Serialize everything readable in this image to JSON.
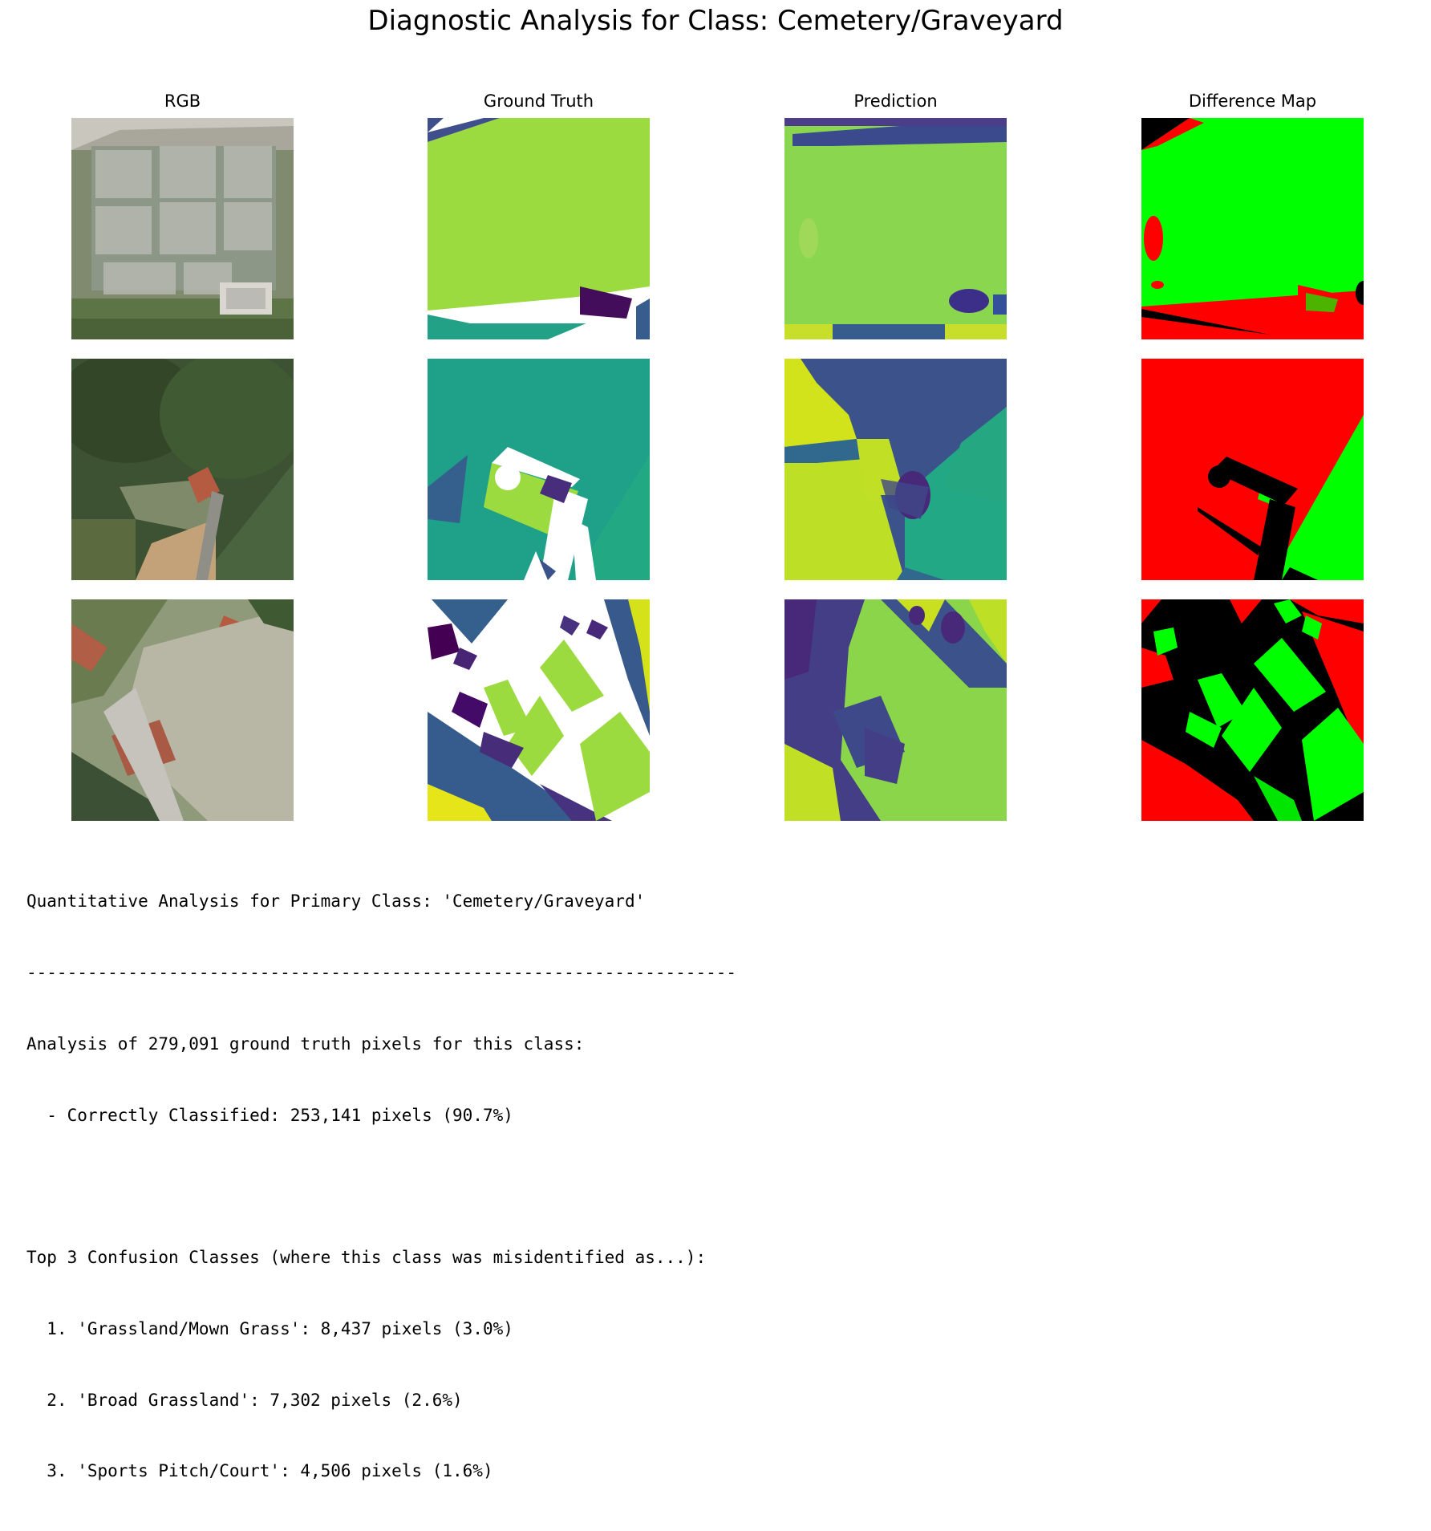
{
  "figure": {
    "title": "Diagnostic Analysis for Class: Cemetery/Graveyard",
    "columns": [
      "RGB",
      "Ground Truth",
      "Prediction",
      "Difference Map"
    ],
    "difference_map_colors": {
      "correct": "#00ff00",
      "incorrect": "#ff0000",
      "ignored": "#000000"
    },
    "colormap": "viridis"
  },
  "report": {
    "heading": "Quantitative Analysis for Primary Class: 'Cemetery/Graveyard'",
    "separator": "----------------------------------------------------------------------",
    "analysis_line": "Analysis of 279,091 ground truth pixels for this class:",
    "correct_line": "  - Correctly Classified: 253,141 pixels (90.7%)",
    "blank": "",
    "confusion_heading": "Top 3 Confusion Classes (where this class was misidentified as...):",
    "confusions": [
      "  1. 'Grassland/Mown Grass': 8,437 pixels (3.0%)",
      "  2. 'Broad Grassland': 7,302 pixels (2.6%)",
      "  3. 'Sports Pitch/Court': 4,506 pixels (1.6%)"
    ]
  }
}
